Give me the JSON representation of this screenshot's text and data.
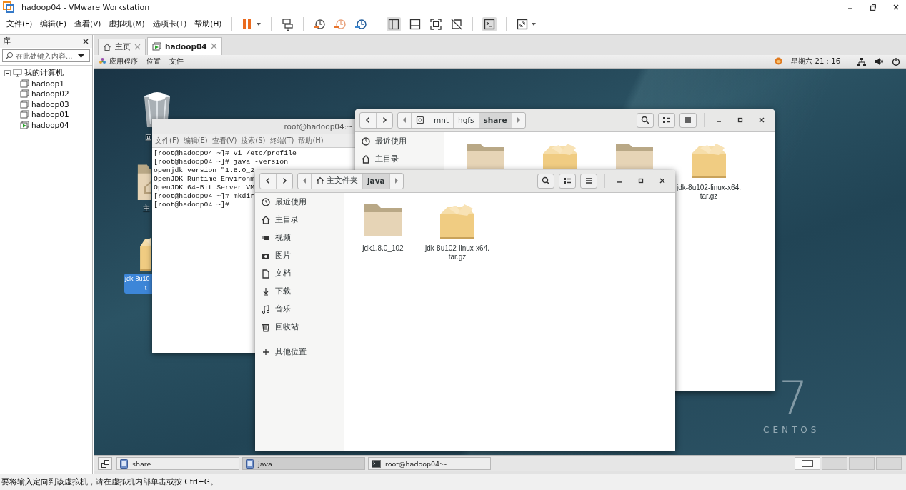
{
  "window": {
    "title": "hadoop04 - VMware Workstation"
  },
  "menu": [
    "文件(F)",
    "编辑(E)",
    "查看(V)",
    "虚拟机(M)",
    "选项卡(T)",
    "帮助(H)"
  ],
  "library": {
    "title": "库",
    "search": {
      "placeholder": "在此处键入内容..."
    },
    "tree": [
      {
        "label": "我的计算机",
        "expanded": true,
        "children": [
          {
            "label": "hadoop1",
            "running": false
          },
          {
            "label": "hadoop02",
            "running": false
          },
          {
            "label": "hadoop03",
            "running": false
          },
          {
            "label": "hadoop01",
            "running": false
          },
          {
            "label": "hadoop04",
            "running": true
          }
        ]
      }
    ]
  },
  "tabs": [
    {
      "label": "主页",
      "kind": "home",
      "selected": false
    },
    {
      "label": "hadoop04",
      "kind": "vm",
      "selected": true
    }
  ],
  "guest": {
    "topbar": {
      "menus": [
        "应用程序",
        "位置",
        "文件"
      ],
      "clock": "星期六 21：16"
    },
    "desktop_icons": [
      {
        "kind": "trash",
        "label": [
          "回"
        ],
        "selected": false
      },
      {
        "kind": "home",
        "label": [
          "主"
        ],
        "selected": false
      },
      {
        "kind": "package",
        "label": [
          "jdk-8u10",
          "t"
        ],
        "selected": true
      }
    ],
    "logo": {
      "number": "7",
      "name": "CENTOS"
    },
    "terminal": {
      "title": "root@hadoop04:~",
      "menu": [
        "文件(F)",
        "编辑(E)",
        "查看(V)",
        "搜索(S)",
        "终端(T)",
        "帮助(H)"
      ],
      "lines": [
        "[root@hadoop04 ~]# vi /etc/profile",
        "[root@hadoop04 ~]# java -version",
        "openjdk version \"1.8.0_2",
        "OpenJDK Runtime Environm",
        "OpenJDK 64-Bit Server VM",
        "[root@hadoop04 ~]# mkdir",
        "[root@hadoop04 ~]#"
      ]
    },
    "file_windows": [
      {
        "path": [
          {
            "kind": "drive",
            "selected": false
          },
          {
            "kind": "dir",
            "label": "mnt",
            "selected": false
          },
          {
            "kind": "dir",
            "label": "hgfs",
            "selected": false
          },
          {
            "kind": "dir",
            "label": "share",
            "selected": true
          }
        ],
        "sidebar": [
          {
            "kind": "recent",
            "label": "最近使用"
          },
          {
            "kind": "home",
            "label": "主目录"
          }
        ],
        "items": [
          {
            "kind": "folder"
          },
          {
            "kind": "package"
          },
          {
            "kind": "folder"
          },
          {
            "kind": "package",
            "label": [
              "jdk-8u102-linux-x64.",
              "tar.gz"
            ]
          }
        ]
      },
      {
        "path": [
          {
            "kind": "home",
            "label": "主文件夹",
            "selected": false
          },
          {
            "kind": "dir",
            "label": "java",
            "selected": true
          }
        ],
        "sidebar": [
          {
            "kind": "recent",
            "label": "最近使用"
          },
          {
            "kind": "home",
            "label": "主目录"
          },
          {
            "kind": "video",
            "label": "视频"
          },
          {
            "kind": "pictures",
            "label": "图片"
          },
          {
            "kind": "documents",
            "label": "文档"
          },
          {
            "kind": "downloads",
            "label": "下载"
          },
          {
            "kind": "music",
            "label": "音乐"
          },
          {
            "kind": "trash",
            "label": "回收站"
          },
          {
            "kind": "other",
            "label": "其他位置"
          }
        ],
        "items": [
          {
            "kind": "folder",
            "label": [
              "jdk1.8.0_102"
            ]
          },
          {
            "kind": "package",
            "label": [
              "jdk-8u102-linux-x64.",
              "tar.gz"
            ]
          }
        ]
      }
    ],
    "taskbar": [
      {
        "kind": "files",
        "label": "share",
        "selected": false
      },
      {
        "kind": "files",
        "label": "java",
        "selected": true
      },
      {
        "kind": "terminal",
        "label": "root@hadoop04:~",
        "selected": false
      }
    ],
    "workspaces": [
      {
        "selected": true
      },
      {
        "selected": false
      },
      {
        "selected": false
      },
      {
        "selected": false
      }
    ]
  },
  "status_bar": "要将输入定向到该虚拟机，请在虚拟机内部单击或按 Ctrl+G。"
}
